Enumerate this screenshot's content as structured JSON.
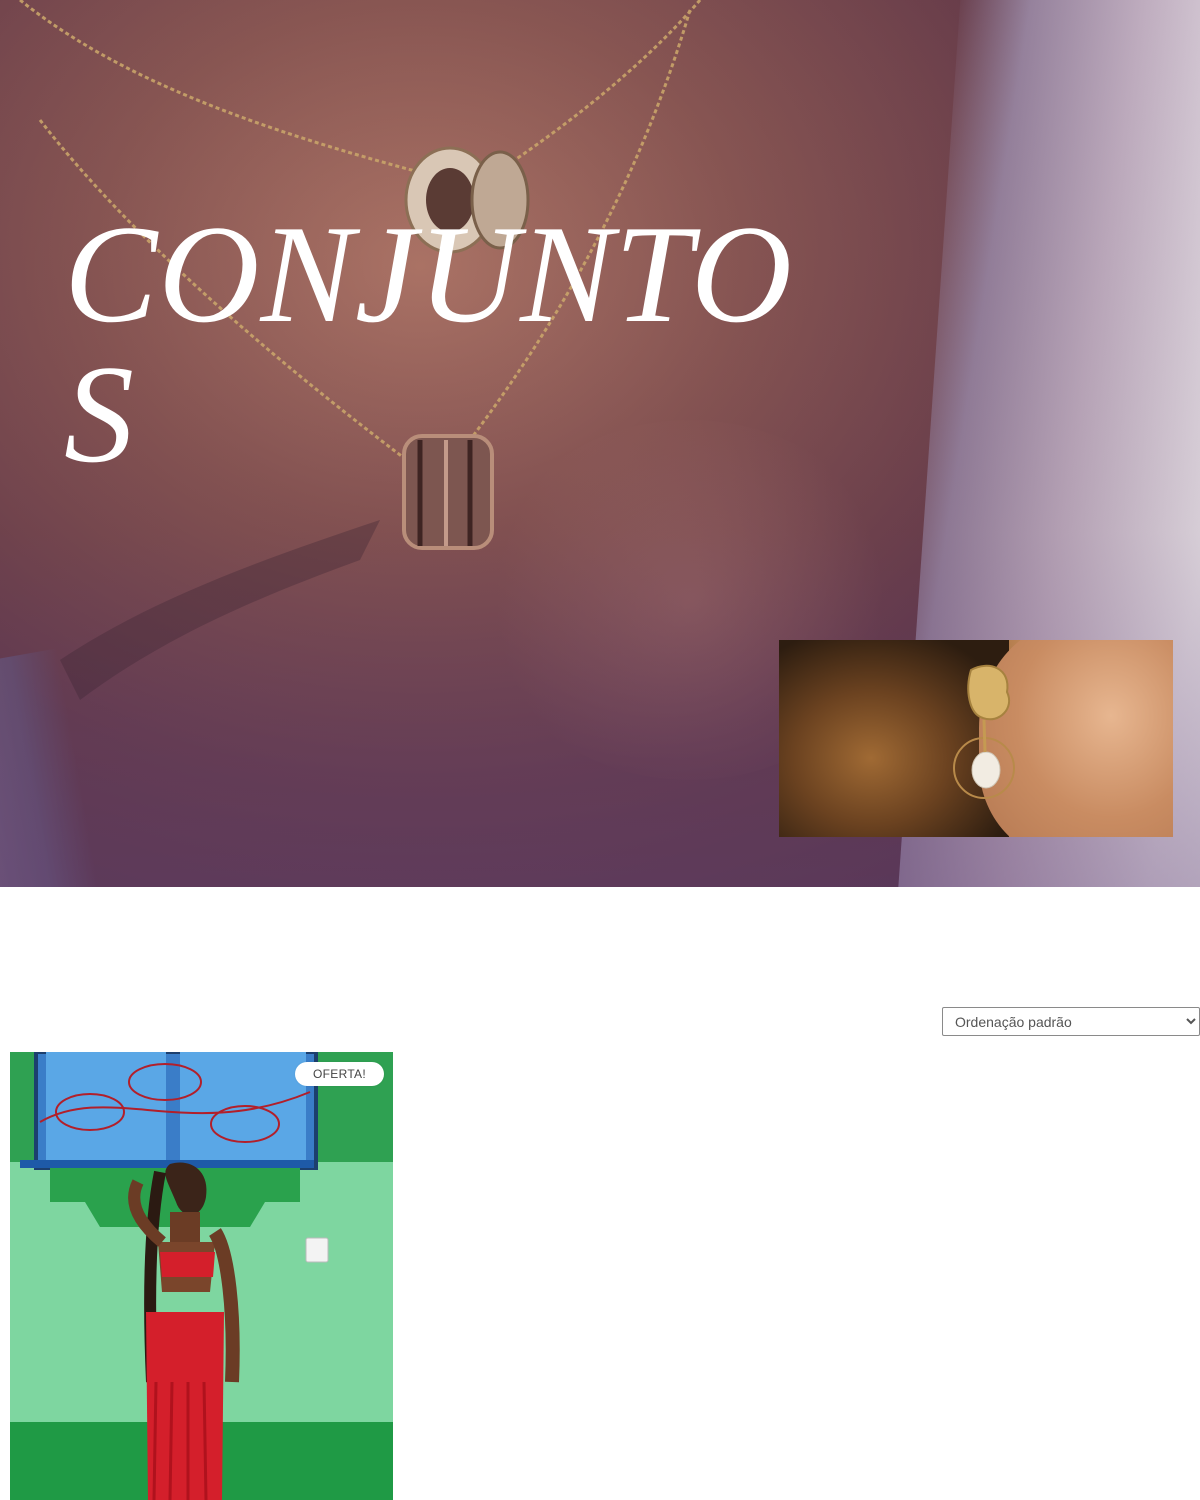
{
  "hero": {
    "title": "CONJUNTOS",
    "main_image": "necklace-photo",
    "inset_image": "earring-photo"
  },
  "sorting": {
    "selected": "Ordenação padrão",
    "options": [
      "Ordenação padrão"
    ]
  },
  "products": [
    {
      "badge": "OFERTA!",
      "image": "red-crochet-outfit-photo"
    }
  ],
  "colors": {
    "badge_bg": "#ffffff",
    "badge_text": "#444444",
    "hero_title": "#ffffff"
  }
}
